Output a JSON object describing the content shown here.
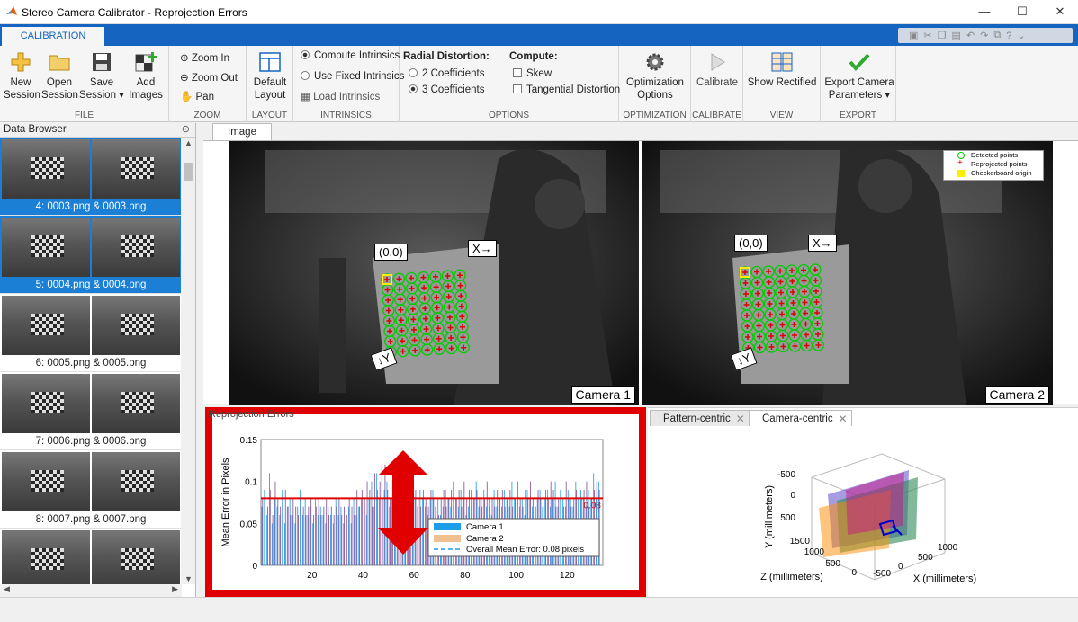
{
  "window": {
    "title": "Stereo Camera Calibrator - Reprojection Errors"
  },
  "window_controls": {
    "minimize": "—",
    "maximize": "☐",
    "close": "✕"
  },
  "ribbon_tab": "CALIBRATION",
  "ribbon": {
    "file": {
      "label": "FILE",
      "new": "New\nSession",
      "open": "Open\nSession",
      "save": "Save\nSession ▾",
      "add": "Add\nImages"
    },
    "zoom": {
      "label": "ZOOM",
      "zoom_in": "Zoom In",
      "zoom_out": "Zoom Out",
      "pan": "Pan"
    },
    "layout": {
      "label": "LAYOUT",
      "default": "Default\nLayout"
    },
    "intrinsics": {
      "label": "INTRINSICS",
      "compute": "Compute Intrinsics",
      "fixed": "Use Fixed Intrinsics",
      "load": "Load Intrinsics"
    },
    "options": {
      "label": "OPTIONS",
      "radial": "Radial Distortion:",
      "c2": "2 Coefficients",
      "c3": "3 Coefficients",
      "compute": "Compute:",
      "skew": "Skew",
      "tangential": "Tangential Distortion"
    },
    "optimization": {
      "label": "OPTIMIZATION",
      "opt": "Optimization\nOptions"
    },
    "calibrate": {
      "label": "CALIBRATE",
      "btn": "Calibrate"
    },
    "view": {
      "label": "VIEW",
      "btn": "Show Rectified"
    },
    "export": {
      "label": "EXPORT",
      "btn": "Export Camera\nParameters ▾"
    }
  },
  "data_browser": {
    "title": "Data Browser",
    "items": [
      {
        "label": "4: 0003.png & 0003.png",
        "selected": true
      },
      {
        "label": "5: 0004.png & 0004.png",
        "selected": true
      },
      {
        "label": "6: 0005.png & 0005.png",
        "selected": false
      },
      {
        "label": "7: 0006.png & 0006.png",
        "selected": false
      },
      {
        "label": "8: 0007.png & 0007.png",
        "selected": false
      },
      {
        "label": "",
        "selected": false
      }
    ]
  },
  "image_tab": "Image",
  "image_view": {
    "origin_label": "(0,0)",
    "x_label": "X→",
    "y_label": "↓Y",
    "camera1": "Camera 1",
    "camera2": "Camera 2",
    "legend": [
      "Detected points",
      "Reprojected points",
      "Checkerboard origin"
    ],
    "legend_colors": [
      "#00cc00",
      "#dd0000",
      "#ffee00"
    ]
  },
  "errors_tab": "Reprojection Errors",
  "right_tabs": {
    "pattern": "Pattern-centric",
    "camera": "Camera-centric"
  },
  "chart_data": {
    "type": "bar",
    "ylabel": "Mean Error in Pixels",
    "ylim": [
      0,
      0.15
    ],
    "yticks": [
      "0",
      "0.05",
      "0.1",
      "0.15"
    ],
    "xlim": [
      0,
      134
    ],
    "xticks": [
      "20",
      "40",
      "60",
      "80",
      "100",
      "120"
    ],
    "series_colors": {
      "Camera 1": "#1e9ee8",
      "Camera 2": "#f0c090"
    },
    "mean_error": 0.08,
    "mean_label": "0.08",
    "legend": [
      "Camera 1",
      "Camera 2",
      "Overall Mean Error: 0.08 pixels"
    ],
    "series": [
      {
        "name": "Camera 1",
        "values": [
          0.07,
          0.09,
          0.06,
          0.11,
          0.05,
          0.08,
          0.07,
          0.06,
          0.09,
          0.05,
          0.07,
          0.08,
          0.06,
          0.05,
          0.07,
          0.09,
          0.06,
          0.08,
          0.06,
          0.07,
          0.05,
          0.08,
          0.06,
          0.07,
          0.06,
          0.05,
          0.07,
          0.06,
          0.05,
          0.08,
          0.06,
          0.07,
          0.05,
          0.06,
          0.07,
          0.05,
          0.08,
          0.06,
          0.07,
          0.08,
          0.09,
          0.06,
          0.08,
          0.1,
          0.07,
          0.11,
          0.08,
          0.12,
          0.09,
          0.1,
          0.07,
          0.08,
          0.1,
          0.09,
          0.11,
          0.07,
          0.08,
          0.09,
          0.07,
          0.06,
          0.08,
          0.07,
          0.09,
          0.08,
          0.07,
          0.06,
          0.08,
          0.09,
          0.07,
          0.08,
          0.06,
          0.07,
          0.09,
          0.08,
          0.07,
          0.1,
          0.08,
          0.07,
          0.09,
          0.08,
          0.06,
          0.07,
          0.09,
          0.08,
          0.1,
          0.07,
          0.08,
          0.09,
          0.07,
          0.08,
          0.06,
          0.09,
          0.07,
          0.08,
          0.07,
          0.09,
          0.08,
          0.07,
          0.1,
          0.08,
          0.09,
          0.07,
          0.08,
          0.06,
          0.09,
          0.08,
          0.07,
          0.1,
          0.08,
          0.09,
          0.07,
          0.08,
          0.09,
          0.07,
          0.08,
          0.1,
          0.07,
          0.09,
          0.08,
          0.07,
          0.09,
          0.08,
          0.07,
          0.1,
          0.08,
          0.09,
          0.08,
          0.07,
          0.09,
          0.08,
          0.11,
          0.08,
          0.1
        ]
      },
      {
        "name": "Camera 2",
        "values": [
          0.08,
          0.06,
          0.07,
          0.09,
          0.06,
          0.1,
          0.08,
          0.07,
          0.06,
          0.09,
          0.07,
          0.06,
          0.08,
          0.07,
          0.06,
          0.08,
          0.07,
          0.06,
          0.07,
          0.08,
          0.06,
          0.07,
          0.08,
          0.06,
          0.07,
          0.08,
          0.06,
          0.07,
          0.06,
          0.07,
          0.08,
          0.06,
          0.07,
          0.06,
          0.08,
          0.07,
          0.06,
          0.09,
          0.07,
          0.09,
          0.08,
          0.1,
          0.09,
          0.07,
          0.11,
          0.09,
          0.1,
          0.08,
          0.12,
          0.09,
          0.08,
          0.1,
          0.08,
          0.1,
          0.09,
          0.1,
          0.09,
          0.08,
          0.07,
          0.08,
          0.09,
          0.08,
          0.07,
          0.09,
          0.08,
          0.07,
          0.09,
          0.08,
          0.07,
          0.06,
          0.08,
          0.09,
          0.07,
          0.08,
          0.09,
          0.07,
          0.08,
          0.09,
          0.07,
          0.1,
          0.08,
          0.09,
          0.07,
          0.08,
          0.09,
          0.08,
          0.07,
          0.08,
          0.1,
          0.07,
          0.08,
          0.07,
          0.09,
          0.08,
          0.09,
          0.07,
          0.08,
          0.09,
          0.07,
          0.08,
          0.1,
          0.08,
          0.07,
          0.09,
          0.08,
          0.1,
          0.08,
          0.07,
          0.09,
          0.08,
          0.07,
          0.09,
          0.08,
          0.1,
          0.09,
          0.07,
          0.08,
          0.09,
          0.07,
          0.1,
          0.08,
          0.07,
          0.08,
          0.09,
          0.07,
          0.08,
          0.09,
          0.1,
          0.07,
          0.08,
          0.09,
          0.1,
          0.09
        ]
      }
    ]
  },
  "extrinsics_chart": {
    "ylabel": "Y (millimeters)",
    "zlabel": "Z (millimeters)",
    "xlabel": "X (millimeters)",
    "yticks": [
      "-500",
      "0",
      "500"
    ],
    "zticks": [
      "1500",
      "1000",
      "500",
      "0"
    ],
    "xticks": [
      "1000",
      "500",
      "0",
      "-500"
    ]
  }
}
